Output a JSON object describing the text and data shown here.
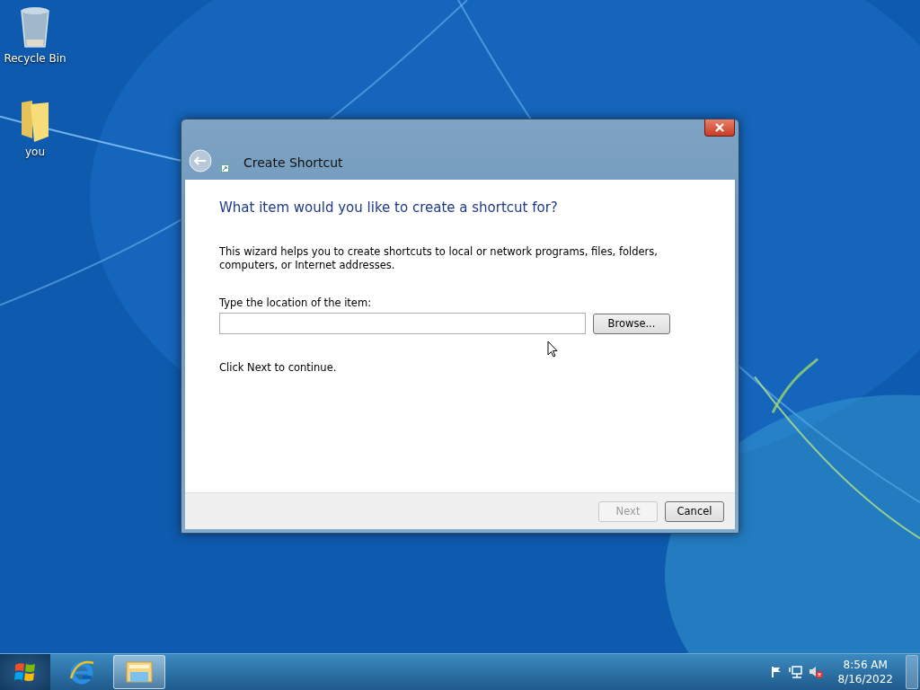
{
  "desktop_icons": [
    {
      "kind": "bin",
      "label": "Recycle Bin"
    },
    {
      "kind": "folder",
      "label": "you"
    }
  ],
  "dialog": {
    "title": "Create Shortcut",
    "heading": "What item would you like to create a shortcut for?",
    "description": "This wizard helps you to create shortcuts to local or network programs, files, folders, computers, or Internet addresses.",
    "field_label": "Type the location of the item:",
    "browse_button": "Browse...",
    "footer_text": "Click Next to continue.",
    "buttons": [
      {
        "label": "Next",
        "disabled": true
      },
      {
        "label": "Cancel",
        "disabled": false
      }
    ]
  },
  "taskbar": {
    "items": [
      {
        "kind": "ie",
        "selected": false
      },
      {
        "kind": "explorer",
        "selected": true
      }
    ],
    "clock": {
      "time": "8:56 AM",
      "date": "8/16/2022"
    }
  }
}
